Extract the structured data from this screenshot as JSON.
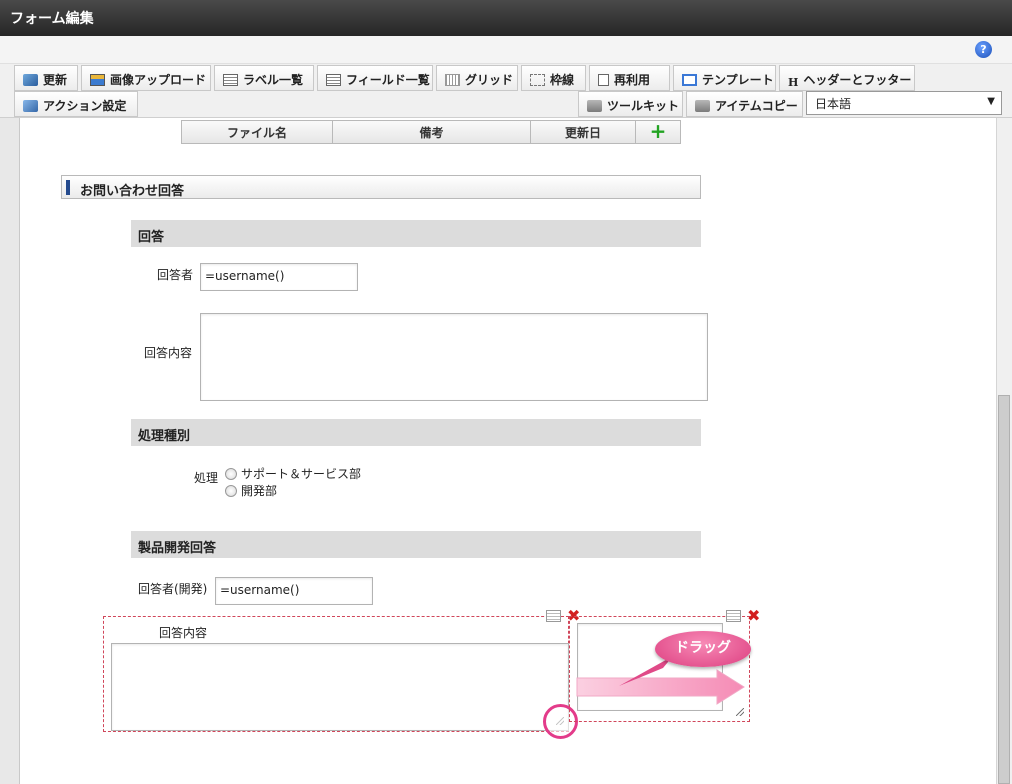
{
  "window": {
    "title": "フォーム編集"
  },
  "toolbar": {
    "row1": [
      {
        "label": "更新",
        "icon": "refresh-icon"
      },
      {
        "label": "画像アップロード",
        "icon": "image-upload-icon"
      },
      {
        "label": "ラベル一覧",
        "icon": "label-list-icon"
      },
      {
        "label": "フィールド一覧",
        "icon": "field-list-icon"
      },
      {
        "label": "グリッド",
        "icon": "grid-icon"
      },
      {
        "label": "枠線",
        "icon": "border-icon"
      },
      {
        "label": "再利用",
        "icon": "reuse-icon"
      },
      {
        "label": "テンプレート",
        "icon": "template-icon"
      },
      {
        "label": "ヘッダーとフッター",
        "icon": "header-footer-icon"
      }
    ],
    "action_settings": "アクション設定",
    "toolkit": "ツールキット",
    "item_copy": "アイテムコピー",
    "language": "日本語"
  },
  "file_table": {
    "headers": [
      "ファイル名",
      "備考",
      "更新日"
    ],
    "add": "+"
  },
  "form": {
    "section_title": "お問い合わせ回答",
    "answer": {
      "title": "回答",
      "respondent_label": "回答者",
      "respondent_value": "=username()",
      "content_label": "回答内容"
    },
    "processing": {
      "title": "処理種別",
      "label": "処理",
      "options": [
        "サポート＆サービス部",
        "開発部"
      ]
    },
    "dev_answer": {
      "title": "製品開発回答",
      "respondent_label": "回答者(開発)",
      "respondent_value": "=username()",
      "content_label": "回答内容"
    }
  },
  "callout": {
    "drag_label": "ドラッグ"
  },
  "colors": {
    "accent": "#e33b8a",
    "section_bar": "#254b8e",
    "delete": "#d21f1f"
  }
}
